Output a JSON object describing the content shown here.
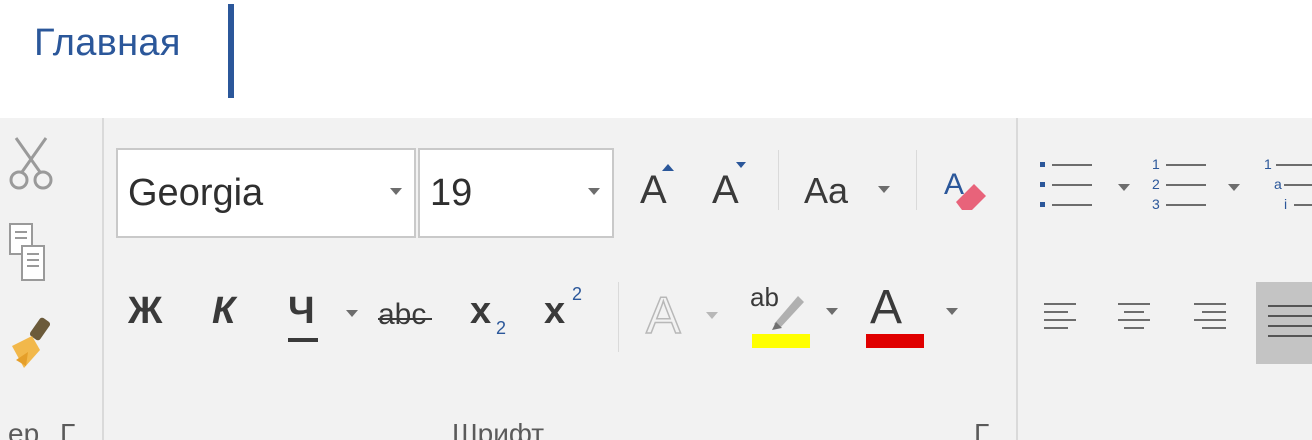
{
  "tabs": {
    "home_label": "Главная"
  },
  "font": {
    "family_value": "Georgia",
    "size_value": "19",
    "grow_glyph": "A",
    "shrink_glyph": "A",
    "case_label": "Aa",
    "bold_glyph": "Ж",
    "italic_glyph": "К",
    "underline_glyph": "Ч",
    "strike_glyph": "abc",
    "subscript_base": "x",
    "subscript_sub": "2",
    "superscript_base": "x",
    "superscript_sup": "2",
    "text_effects_glyph": "A",
    "highlight_glyph": "ab",
    "font_color_glyph": "A",
    "group_label": "Шрифт",
    "launcher_glyph": "Г"
  },
  "clipboard": {
    "group_label": "ер",
    "launcher_glyph": "Г"
  },
  "paragraph": {
    "bullets_icon": "bullets-list-icon",
    "numbering_labels": [
      "1",
      "2",
      "3"
    ],
    "multilevel_labels": [
      "1",
      "a",
      "i"
    ]
  },
  "colors": {
    "accent": "#2b579a",
    "highlight": "#ffff00",
    "font_color": "#e00000",
    "eraser": "#e8637a"
  }
}
